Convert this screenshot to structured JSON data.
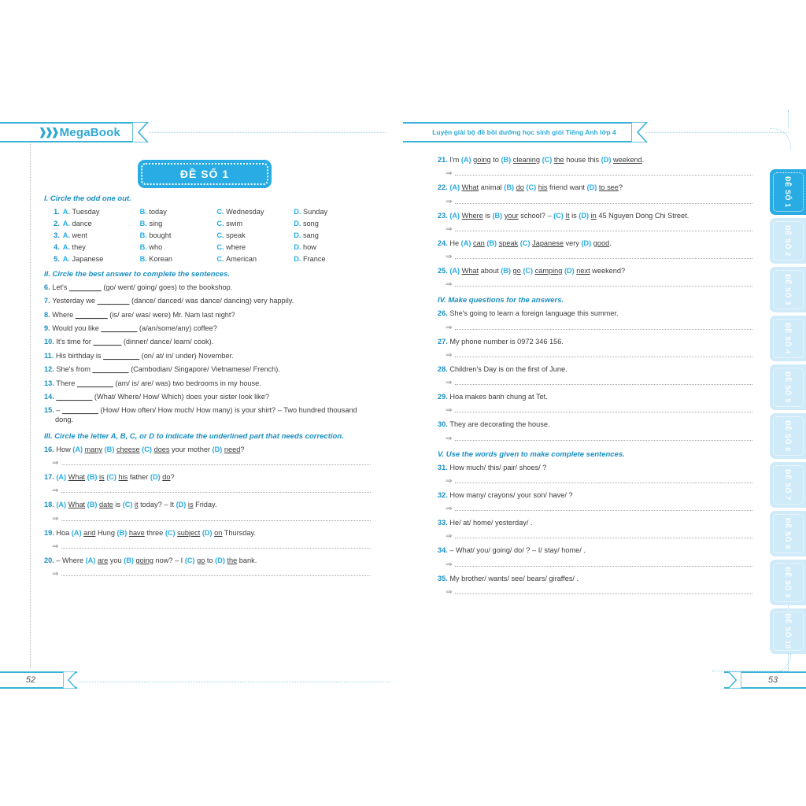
{
  "book": {
    "brand": "MegaBook",
    "running_header": "Luyện giải bộ đề bồi dưỡng học sinh giỏi Tiếng Anh lớp 4",
    "exam_title": "ĐỀ SỐ 1",
    "page_left": "52",
    "page_right": "53",
    "accent_blue": "#29ace3",
    "heading_blue": "#1a8fc1",
    "tab_blue_inactive": "#cfeaf8"
  },
  "side_tabs": [
    {
      "label": "ĐỀ SỐ 1",
      "active": true
    },
    {
      "label": "ĐỀ SỐ 2",
      "active": false
    },
    {
      "label": "ĐỀ SỐ 3",
      "active": false
    },
    {
      "label": "ĐỀ SỐ 4",
      "active": false
    },
    {
      "label": "ĐỀ SỐ 5",
      "active": false
    },
    {
      "label": "ĐỀ SỐ 6",
      "active": false
    },
    {
      "label": "ĐỀ SỐ 7",
      "active": false
    },
    {
      "label": "ĐỀ SỐ 8",
      "active": false
    },
    {
      "label": "ĐỀ SỐ 9",
      "active": false
    },
    {
      "label": "ĐỀ SỐ 10",
      "active": false
    }
  ],
  "sections": {
    "s1": {
      "heading": "I. Circle the odd one out.",
      "items": [
        {
          "n": "1.",
          "a": "Tuesday",
          "b": "today",
          "c": "Wednesday",
          "d": "Sunday"
        },
        {
          "n": "2.",
          "a": "dance",
          "b": "sing",
          "c": "swim",
          "d": "song"
        },
        {
          "n": "3.",
          "a": "went",
          "b": "bought",
          "c": "speak",
          "d": "sang"
        },
        {
          "n": "4.",
          "a": "they",
          "b": "who",
          "c": "where",
          "d": "how"
        },
        {
          "n": "5.",
          "a": "Japanese",
          "b": "Korean",
          "c": "American",
          "d": "France"
        }
      ],
      "letters": {
        "a": "A.",
        "b": "B.",
        "c": "C.",
        "d": "D."
      }
    },
    "s2": {
      "heading": "II. Circle the best answer to complete the sentences.",
      "items": [
        {
          "n": "6.",
          "pre": "Let's ",
          "blank": "________",
          "post": " (go/ went/ going/ goes) to the bookshop."
        },
        {
          "n": "7.",
          "pre": "Yesterday we ",
          "blank": "________",
          "post": " (dance/ danced/ was dance/ dancing) very happily."
        },
        {
          "n": "8.",
          "pre": "Where ",
          "blank": "________",
          "post": " (is/ are/ was/ were) Mr. Nam last night?"
        },
        {
          "n": "9.",
          "pre": "Would you like ",
          "blank": "_________",
          "post": " (a/an/some/any) coffee?"
        },
        {
          "n": "10.",
          "pre": "It's time for ",
          "blank": "_______",
          "post": " (dinner/ dance/ learn/ cook)."
        },
        {
          "n": "11.",
          "pre": "His birthday is ",
          "blank": "_________",
          "post": " (on/ at/ in/ under) November."
        },
        {
          "n": "12.",
          "pre": "She's from ",
          "blank": "_________",
          "post": " (Cambodian/ Singapore/ Vietnamese/ French)."
        },
        {
          "n": "13.",
          "pre": "There ",
          "blank": "_________",
          "post": " (am/ is/ are/ was) two bedrooms in my house."
        },
        {
          "n": "14.",
          "pre": "",
          "blank": "_________",
          "post": " (What/ Where/ How/ Which) does your sister look like?"
        },
        {
          "n": "15.",
          "pre": "– ",
          "blank": "_________",
          "post": " (How/ How often/ How much/ How many) is your shirt? – Two hundred thousand dong."
        }
      ]
    },
    "s3": {
      "heading": "III. Circle the letter A, B, C, or D to indicate the underlined part that needs correction.",
      "items": [
        {
          "n": "16.",
          "parts": [
            {
              "t": "How ",
              "k": "plain"
            },
            {
              "t": "(A)",
              "k": "opt"
            },
            {
              "t": " ",
              "k": "plain"
            },
            {
              "t": "many",
              "k": "ul"
            },
            {
              "t": " ",
              "k": "plain"
            },
            {
              "t": "(B)",
              "k": "opt"
            },
            {
              "t": " ",
              "k": "plain"
            },
            {
              "t": "cheese",
              "k": "ul"
            },
            {
              "t": " ",
              "k": "plain"
            },
            {
              "t": "(C)",
              "k": "opt"
            },
            {
              "t": " ",
              "k": "plain"
            },
            {
              "t": "does",
              "k": "ul"
            },
            {
              "t": " your mother ",
              "k": "plain"
            },
            {
              "t": "(D)",
              "k": "opt"
            },
            {
              "t": " ",
              "k": "plain"
            },
            {
              "t": "need",
              "k": "ul"
            },
            {
              "t": "?",
              "k": "plain"
            }
          ]
        },
        {
          "n": "17.",
          "parts": [
            {
              "t": "(A)",
              "k": "opt"
            },
            {
              "t": " ",
              "k": "plain"
            },
            {
              "t": "What",
              "k": "ul"
            },
            {
              "t": " ",
              "k": "plain"
            },
            {
              "t": "(B)",
              "k": "opt"
            },
            {
              "t": " ",
              "k": "plain"
            },
            {
              "t": "is",
              "k": "ul"
            },
            {
              "t": " ",
              "k": "plain"
            },
            {
              "t": "(C)",
              "k": "opt"
            },
            {
              "t": " ",
              "k": "plain"
            },
            {
              "t": "his",
              "k": "ul"
            },
            {
              "t": " father ",
              "k": "plain"
            },
            {
              "t": "(D)",
              "k": "opt"
            },
            {
              "t": " ",
              "k": "plain"
            },
            {
              "t": "do",
              "k": "ul"
            },
            {
              "t": "?",
              "k": "plain"
            }
          ]
        },
        {
          "n": "18.",
          "parts": [
            {
              "t": "(A)",
              "k": "opt"
            },
            {
              "t": " ",
              "k": "plain"
            },
            {
              "t": "What",
              "k": "ul"
            },
            {
              "t": " ",
              "k": "plain"
            },
            {
              "t": "(B)",
              "k": "opt"
            },
            {
              "t": " ",
              "k": "plain"
            },
            {
              "t": "date",
              "k": "ul"
            },
            {
              "t": " is ",
              "k": "plain"
            },
            {
              "t": "(C)",
              "k": "opt"
            },
            {
              "t": " ",
              "k": "plain"
            },
            {
              "t": "it",
              "k": "ul"
            },
            {
              "t": " today? – It ",
              "k": "plain"
            },
            {
              "t": "(D)",
              "k": "opt"
            },
            {
              "t": " ",
              "k": "plain"
            },
            {
              "t": "is",
              "k": "ul"
            },
            {
              "t": " Friday.",
              "k": "plain"
            }
          ]
        },
        {
          "n": "19.",
          "parts": [
            {
              "t": "Hoa ",
              "k": "plain"
            },
            {
              "t": "(A)",
              "k": "opt"
            },
            {
              "t": " ",
              "k": "plain"
            },
            {
              "t": "and",
              "k": "ul"
            },
            {
              "t": " Hung ",
              "k": "plain"
            },
            {
              "t": "(B)",
              "k": "opt"
            },
            {
              "t": " ",
              "k": "plain"
            },
            {
              "t": "have",
              "k": "ul"
            },
            {
              "t": " three ",
              "k": "plain"
            },
            {
              "t": "(C)",
              "k": "opt"
            },
            {
              "t": " ",
              "k": "plain"
            },
            {
              "t": "subject",
              "k": "ul"
            },
            {
              "t": " ",
              "k": "plain"
            },
            {
              "t": "(D)",
              "k": "opt"
            },
            {
              "t": " ",
              "k": "plain"
            },
            {
              "t": "on",
              "k": "ul"
            },
            {
              "t": " Thursday.",
              "k": "plain"
            }
          ]
        },
        {
          "n": "20.",
          "parts": [
            {
              "t": "– Where ",
              "k": "plain"
            },
            {
              "t": "(A)",
              "k": "opt"
            },
            {
              "t": " ",
              "k": "plain"
            },
            {
              "t": "are",
              "k": "ul"
            },
            {
              "t": " you ",
              "k": "plain"
            },
            {
              "t": "(B)",
              "k": "opt"
            },
            {
              "t": " ",
              "k": "plain"
            },
            {
              "t": "going",
              "k": "ul"
            },
            {
              "t": " now? – I ",
              "k": "plain"
            },
            {
              "t": "(C)",
              "k": "opt"
            },
            {
              "t": " ",
              "k": "plain"
            },
            {
              "t": "go",
              "k": "ul"
            },
            {
              "t": " to ",
              "k": "plain"
            },
            {
              "t": "(D)",
              "k": "opt"
            },
            {
              "t": " ",
              "k": "plain"
            },
            {
              "t": "the",
              "k": "ul"
            },
            {
              "t": " bank.",
              "k": "plain"
            }
          ]
        },
        {
          "n": "21.",
          "parts": [
            {
              "t": "I'm ",
              "k": "plain"
            },
            {
              "t": "(A)",
              "k": "opt"
            },
            {
              "t": " ",
              "k": "plain"
            },
            {
              "t": "going",
              "k": "ul"
            },
            {
              "t": " to ",
              "k": "plain"
            },
            {
              "t": "(B)",
              "k": "opt"
            },
            {
              "t": " ",
              "k": "plain"
            },
            {
              "t": "cleaning",
              "k": "ul"
            },
            {
              "t": " ",
              "k": "plain"
            },
            {
              "t": "(C)",
              "k": "opt"
            },
            {
              "t": " ",
              "k": "plain"
            },
            {
              "t": "the",
              "k": "ul"
            },
            {
              "t": " house this ",
              "k": "plain"
            },
            {
              "t": "(D)",
              "k": "opt"
            },
            {
              "t": " ",
              "k": "plain"
            },
            {
              "t": "weekend",
              "k": "ul"
            },
            {
              "t": ".",
              "k": "plain"
            }
          ]
        },
        {
          "n": "22.",
          "parts": [
            {
              "t": "(A)",
              "k": "opt"
            },
            {
              "t": " ",
              "k": "plain"
            },
            {
              "t": "What",
              "k": "ul"
            },
            {
              "t": " animal ",
              "k": "plain"
            },
            {
              "t": "(B)",
              "k": "opt"
            },
            {
              "t": " ",
              "k": "plain"
            },
            {
              "t": "do",
              "k": "ul"
            },
            {
              "t": " ",
              "k": "plain"
            },
            {
              "t": "(C)",
              "k": "opt"
            },
            {
              "t": " ",
              "k": "plain"
            },
            {
              "t": "his",
              "k": "ul"
            },
            {
              "t": " friend want ",
              "k": "plain"
            },
            {
              "t": "(D)",
              "k": "opt"
            },
            {
              "t": " ",
              "k": "plain"
            },
            {
              "t": "to see",
              "k": "ul"
            },
            {
              "t": "?",
              "k": "plain"
            }
          ]
        },
        {
          "n": "23.",
          "parts": [
            {
              "t": "(A)",
              "k": "opt"
            },
            {
              "t": " ",
              "k": "plain"
            },
            {
              "t": "Where",
              "k": "ul"
            },
            {
              "t": " is ",
              "k": "plain"
            },
            {
              "t": "(B)",
              "k": "opt"
            },
            {
              "t": " ",
              "k": "plain"
            },
            {
              "t": "your",
              "k": "ul"
            },
            {
              "t": " school? – ",
              "k": "plain"
            },
            {
              "t": "(C)",
              "k": "opt"
            },
            {
              "t": " ",
              "k": "plain"
            },
            {
              "t": "It",
              "k": "ul"
            },
            {
              "t": " is ",
              "k": "plain"
            },
            {
              "t": "(D)",
              "k": "opt"
            },
            {
              "t": " ",
              "k": "plain"
            },
            {
              "t": "in",
              "k": "ul"
            },
            {
              "t": " 45 Nguyen Dong Chi Street.",
              "k": "plain"
            }
          ]
        },
        {
          "n": "24.",
          "parts": [
            {
              "t": "He ",
              "k": "plain"
            },
            {
              "t": "(A)",
              "k": "opt"
            },
            {
              "t": " ",
              "k": "plain"
            },
            {
              "t": "can",
              "k": "ul"
            },
            {
              "t": " ",
              "k": "plain"
            },
            {
              "t": "(B)",
              "k": "opt"
            },
            {
              "t": " ",
              "k": "plain"
            },
            {
              "t": "speak",
              "k": "ul"
            },
            {
              "t": " ",
              "k": "plain"
            },
            {
              "t": "(C)",
              "k": "opt"
            },
            {
              "t": " ",
              "k": "plain"
            },
            {
              "t": "Japanese",
              "k": "ul"
            },
            {
              "t": " very ",
              "k": "plain"
            },
            {
              "t": "(D)",
              "k": "opt"
            },
            {
              "t": " ",
              "k": "plain"
            },
            {
              "t": "good",
              "k": "ul"
            },
            {
              "t": ".",
              "k": "plain"
            }
          ]
        },
        {
          "n": "25.",
          "parts": [
            {
              "t": "(A)",
              "k": "opt"
            },
            {
              "t": " ",
              "k": "plain"
            },
            {
              "t": "What",
              "k": "ul"
            },
            {
              "t": " about ",
              "k": "plain"
            },
            {
              "t": "(B)",
              "k": "opt"
            },
            {
              "t": " ",
              "k": "plain"
            },
            {
              "t": "go",
              "k": "ul"
            },
            {
              "t": " ",
              "k": "plain"
            },
            {
              "t": "(C)",
              "k": "opt"
            },
            {
              "t": " ",
              "k": "plain"
            },
            {
              "t": "camping",
              "k": "ul"
            },
            {
              "t": " ",
              "k": "plain"
            },
            {
              "t": "(D)",
              "k": "opt"
            },
            {
              "t": " ",
              "k": "plain"
            },
            {
              "t": "next",
              "k": "ul"
            },
            {
              "t": " weekend?",
              "k": "plain"
            }
          ]
        }
      ]
    },
    "s4": {
      "heading": "IV. Make questions for the answers.",
      "items": [
        {
          "n": "26.",
          "text": "She's going to learn a foreign language this summer."
        },
        {
          "n": "27.",
          "text": "My phone number is 0972 346 156."
        },
        {
          "n": "28.",
          "text": "Children's Day is on the first of June."
        },
        {
          "n": "29.",
          "text": "Hoa makes banh chung at Tet."
        },
        {
          "n": "30.",
          "text": "They are decorating the house."
        }
      ]
    },
    "s5": {
      "heading": "V. Use the words given to make complete sentences.",
      "items": [
        {
          "n": "31.",
          "text": "How much/ this/ pair/ shoes/ ?"
        },
        {
          "n": "32.",
          "text": "How many/ crayons/ your son/ have/ ?"
        },
        {
          "n": "33.",
          "text": "He/ at/ home/ yesterday/ ."
        },
        {
          "n": "34.",
          "text": "– What/ you/ going/ do/ ? – I/ stay/ home/ ."
        },
        {
          "n": "35.",
          "text": "My brother/ wants/ see/ bears/ giraffes/ ."
        }
      ]
    }
  },
  "glyphs": {
    "arrow": "⇒",
    "chevrons": "❱❱❱"
  }
}
